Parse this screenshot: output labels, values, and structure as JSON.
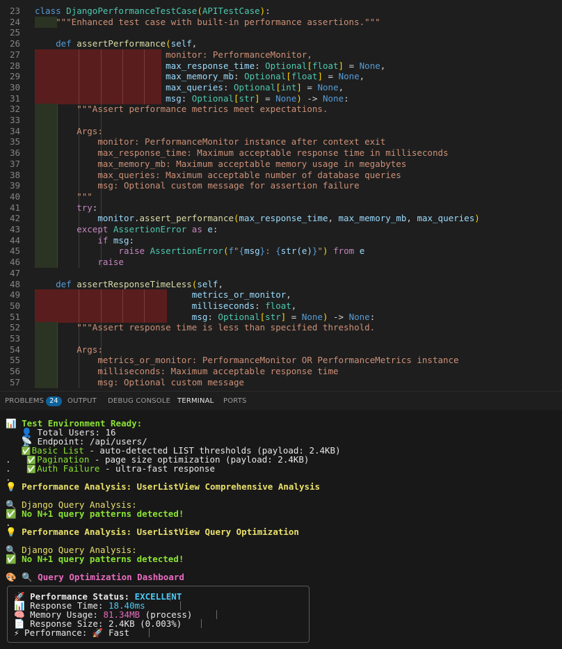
{
  "editor": {
    "lines": [
      {
        "n": "23",
        "text": "class DjangoPerformanceTestCase(APITestCase):"
      },
      {
        "n": "24",
        "text": "    \"\"\"Enhanced test case with built-in performance assertions.\"\"\""
      },
      {
        "n": "25",
        "text": ""
      },
      {
        "n": "26",
        "text": "    def assertPerformance(self,"
      },
      {
        "n": "27",
        "text": "                         monitor: PerformanceMonitor,"
      },
      {
        "n": "28",
        "text": "                         max_response_time: Optional[float] = None,"
      },
      {
        "n": "29",
        "text": "                         max_memory_mb: Optional[float] = None,"
      },
      {
        "n": "30",
        "text": "                         max_queries: Optional[int] = None,"
      },
      {
        "n": "31",
        "text": "                         msg: Optional[str] = None) -> None:"
      },
      {
        "n": "32",
        "text": "        \"\"\"Assert performance metrics meet expectations."
      },
      {
        "n": "33",
        "text": ""
      },
      {
        "n": "34",
        "text": "        Args:"
      },
      {
        "n": "35",
        "text": "            monitor: PerformanceMonitor instance after context exit"
      },
      {
        "n": "36",
        "text": "            max_response_time: Maximum acceptable response time in milliseconds"
      },
      {
        "n": "37",
        "text": "            max_memory_mb: Maximum acceptable memory usage in megabytes"
      },
      {
        "n": "38",
        "text": "            max_queries: Maximum acceptable number of database queries"
      },
      {
        "n": "39",
        "text": "            msg: Optional custom message for assertion failure"
      },
      {
        "n": "40",
        "text": "        \"\"\""
      },
      {
        "n": "41",
        "text": "        try:"
      },
      {
        "n": "42",
        "text": "            monitor.assert_performance(max_response_time, max_memory_mb, max_queries)"
      },
      {
        "n": "43",
        "text": "        except AssertionError as e:"
      },
      {
        "n": "44",
        "text": "            if msg:"
      },
      {
        "n": "45",
        "text": "                raise AssertionError(f\"{msg}: {str(e)}\") from e"
      },
      {
        "n": "46",
        "text": "            raise"
      },
      {
        "n": "47",
        "text": ""
      },
      {
        "n": "48",
        "text": "    def assertResponseTimeLess(self,"
      },
      {
        "n": "49",
        "text": "                              metrics_or_monitor,"
      },
      {
        "n": "50",
        "text": "                              milliseconds: float,"
      },
      {
        "n": "51",
        "text": "                              msg: Optional[str] = None) -> None:"
      },
      {
        "n": "52",
        "text": "        \"\"\"Assert response time is less than specified threshold."
      },
      {
        "n": "53",
        "text": ""
      },
      {
        "n": "54",
        "text": "        Args:"
      },
      {
        "n": "55",
        "text": "            metrics_or_monitor: PerformanceMonitor OR PerformanceMetrics instance"
      },
      {
        "n": "56",
        "text": "            milliseconds: Maximum acceptable response time"
      },
      {
        "n": "57",
        "text": "            msg: Optional custom message"
      }
    ]
  },
  "panel": {
    "tabs": [
      {
        "label": "PROBLEMS",
        "badge": "24"
      },
      {
        "label": "OUTPUT"
      },
      {
        "label": "DEBUG CONSOLE"
      },
      {
        "label": "TERMINAL",
        "active": true
      },
      {
        "label": "PORTS"
      }
    ]
  },
  "terminal": {
    "env_title": "📊 Test Environment Ready:",
    "total_users": "   👤 Total Users: 16",
    "endpoint": "   📡 Endpoint: /api/users/",
    "basic_list_name": "Basic List",
    "basic_list_rest": " - auto-detected LIST thresholds (payload: 2.4KB)",
    "pagination_name": "Pagination",
    "pagination_rest": " - page size optimization (payload: 2.4KB)",
    "auth_name": "Auth Failure",
    "auth_rest": " - ultra-fast response",
    "analysis1": "💡 Performance Analysis: UserListView Comprehensive Analysis",
    "django_query1": "🔍 Django Query Analysis:",
    "no_n1_1": "✅ No N+1 query patterns detected!",
    "analysis2": "💡 Performance Analysis: UserListView Query Optimization",
    "django_query2": "🔍 Django Query Analysis:",
    "no_n1_2": "✅ No N+1 query patterns detected!",
    "dashboard_title": "🎨 🔍 Query Optimization Dashboard",
    "dashboard": {
      "status_label": "🚀 Performance Status: ",
      "status_value": "EXCELLENT",
      "response_time_label": "📊 Response Time: ",
      "response_time_value": "18.40ms",
      "memory_label": "🧠 Memory Usage: ",
      "memory_value": "81.34MB",
      "memory_suffix": " (process)",
      "size_line": "📄 Response Size: 2.4KB (0.003%)",
      "perf_line": "⚡ Performance: 🚀 Fast"
    }
  }
}
